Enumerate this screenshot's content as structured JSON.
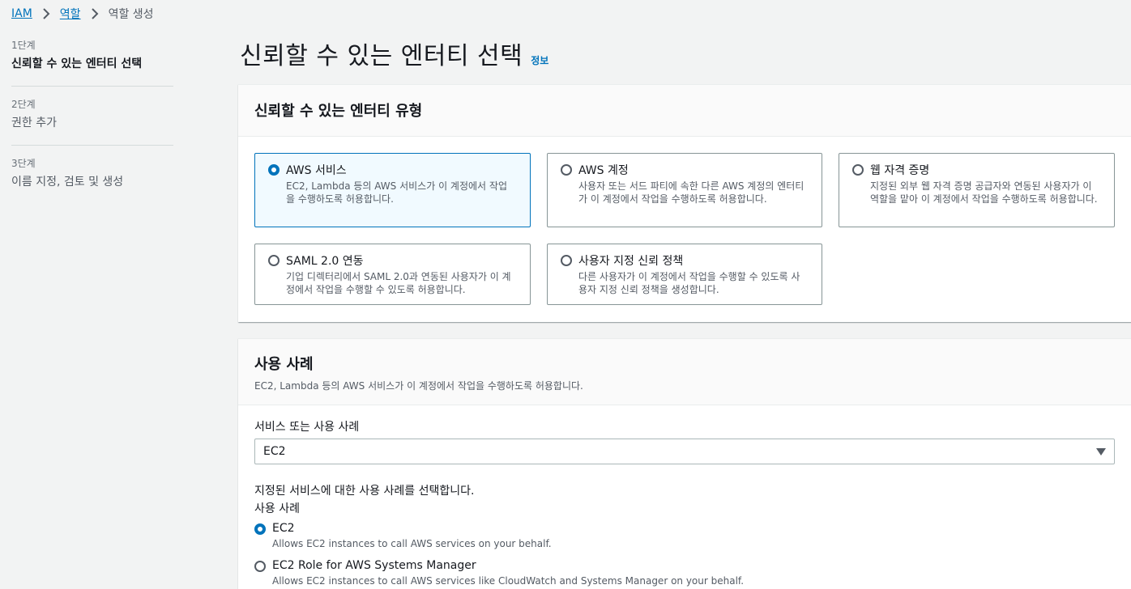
{
  "breadcrumb": {
    "root": "IAM",
    "parent": "역할",
    "current": "역할 생성"
  },
  "steps": [
    {
      "num": "1단계",
      "name": "신뢰할 수 있는 엔터티 선택"
    },
    {
      "num": "2단계",
      "name": "권한 추가"
    },
    {
      "num": "3단계",
      "name": "이름 지정, 검토 및 생성"
    }
  ],
  "page": {
    "title": "신뢰할 수 있는 엔터티 선택",
    "info": "정보"
  },
  "entity_panel": {
    "heading": "신뢰할 수 있는 엔터티 유형",
    "options": [
      {
        "title": "AWS 서비스",
        "text": "EC2, Lambda 등의 AWS 서비스가 이 계정에서 작업을 수행하도록 허용합니다.",
        "selected": true
      },
      {
        "title": "AWS 계정",
        "text": "사용자 또는 서드 파티에 속한 다른 AWS 계정의 엔터티가 이 계정에서 작업을 수행하도록 허용합니다.",
        "selected": false
      },
      {
        "title": "웹 자격 증명",
        "text": "지정된 외부 웹 자격 증명 공급자와 연동된 사용자가 이 역할을 맡아 이 계정에서 작업을 수행하도록 허용합니다.",
        "selected": false
      },
      {
        "title": "SAML 2.0 연동",
        "text": "기업 디렉터리에서 SAML 2.0과 연동된 사용자가 이 계정에서 작업을 수행할 수 있도록 허용합니다.",
        "selected": false
      },
      {
        "title": "사용자 지정 신뢰 정책",
        "text": "다른 사용자가 이 계정에서 작업을 수행할 수 있도록 사용자 지정 신뢰 정책을 생성합니다.",
        "selected": false
      }
    ]
  },
  "usecase_panel": {
    "heading": "사용 사례",
    "description": "EC2, Lambda 등의 AWS 서비스가 이 계정에서 작업을 수행하도록 허용합니다.",
    "service_label": "서비스 또는 사용 사례",
    "service_value": "EC2",
    "choose_text": "지정된 서비스에 대한 사용 사례를 선택합니다.",
    "usecase_label": "사용 사례",
    "options": [
      {
        "title": "EC2",
        "text": "Allows EC2 instances to call AWS services on your behalf.",
        "selected": true
      },
      {
        "title": "EC2 Role for AWS Systems Manager",
        "text": "Allows EC2 instances to call AWS services like CloudWatch and Systems Manager on your behalf.",
        "selected": false
      }
    ]
  },
  "colors": {
    "link": "#0073bb",
    "selected_bg": "#f1faff",
    "border": "#879596"
  }
}
